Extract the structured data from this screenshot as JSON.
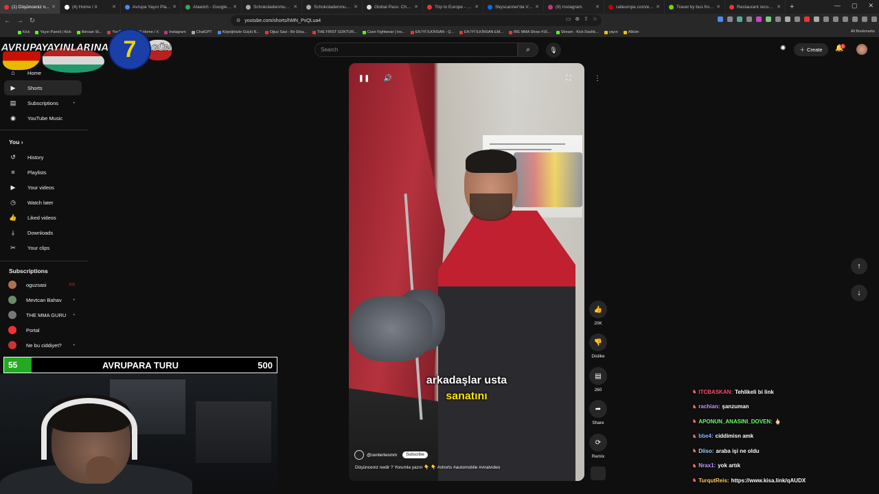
{
  "browser": {
    "tabs": [
      {
        "title": "(1) Düşünceniz n...",
        "color": "#e33",
        "active": true
      },
      {
        "title": "(4) Home / X",
        "color": "#fff"
      },
      {
        "title": "Avrupa Yayın Planlam",
        "color": "#4a8af4"
      },
      {
        "title": "Atawich - Google Maps",
        "color": "#34a853"
      },
      {
        "title": "Schokoladenmuseum Kö",
        "color": "#aaa"
      },
      {
        "title": "Schokoladenmuseum Kö",
        "color": "#aaa"
      },
      {
        "title": "Global Pass: Cheapest R",
        "color": "#ddd"
      },
      {
        "title": "Trip to Europe - Wande",
        "color": "#e33"
      },
      {
        "title": "Skyscanner'da Venedik",
        "color": "#0770e3"
      },
      {
        "title": "(9) Instagram",
        "color": "#c13584"
      },
      {
        "title": "raileurope.com/en/pass",
        "color": "#c00"
      },
      {
        "title": "Travel by bus from Colo",
        "color": "#73d700"
      },
      {
        "title": "Restaurant recommenda",
        "color": "#e33"
      }
    ],
    "new_tab": "+",
    "url": "youtube.com/shorts/hMN_PxQLua4",
    "bookmarks": [
      {
        "label": "Kick",
        "color": "#53fc18"
      },
      {
        "label": "Yayın Paneli | Kick",
        "color": "#53fc18"
      },
      {
        "label": "ilkinsan St...",
        "color": "#53fc18"
      },
      {
        "label": "YouTube",
        "color": "#e33"
      },
      {
        "label": "(4) Home / X",
        "color": "#fff"
      },
      {
        "label": "Instagram",
        "color": "#c13584"
      },
      {
        "label": "ChatGPT",
        "color": "#aaa"
      },
      {
        "label": "Köpeğinizle Güçlü B...",
        "color": "#4a8af4"
      },
      {
        "label": "Oğuz Sasi - Bir Efsa...",
        "color": "#e33"
      },
      {
        "label": "THE FIRST GOKTUR...",
        "color": "#e33"
      },
      {
        "label": "Cave Fightwear | Ins...",
        "color": "#53fc18"
      },
      {
        "label": "EN İYİ İLKİNSAN - Q...",
        "color": "#e33"
      },
      {
        "label": "EN İYİ İLKİNSAN EM...",
        "color": "#e33"
      },
      {
        "label": "IRE MMA Show #16...",
        "color": "#e33"
      },
      {
        "label": "Stream - Kick Dashb...",
        "color": "#53fc18"
      },
      {
        "label": "yayın",
        "color": "#f2c500"
      },
      {
        "label": "Albüm",
        "color": "#f2c500"
      }
    ],
    "all_bookmarks": "All Bookmarks"
  },
  "overlay_logo": {
    "text": "AVRUPAYAYINLARINA",
    "number": "7",
    "suffix": "GÜN"
  },
  "header": {
    "search_placeholder": "Search",
    "create_label": "Create",
    "notification_count": "1"
  },
  "sidebar": {
    "main": [
      {
        "label": "Home",
        "icon": "⌂"
      },
      {
        "label": "Shorts",
        "icon": "▶",
        "active": true
      },
      {
        "label": "Subscriptions",
        "icon": "▤",
        "dot": true
      },
      {
        "label": "YouTube Music",
        "icon": "◉"
      }
    ],
    "you_heading": "You",
    "you_items": [
      {
        "label": "History",
        "icon": "↺"
      },
      {
        "label": "Playlists",
        "icon": "≡"
      },
      {
        "label": "Your videos",
        "icon": "▶"
      },
      {
        "label": "Watch later",
        "icon": "◷"
      },
      {
        "label": "Liked videos",
        "icon": "👍"
      },
      {
        "label": "Downloads",
        "icon": "⤓"
      },
      {
        "label": "Your clips",
        "icon": "✂"
      }
    ],
    "subs_heading": "Subscriptions",
    "subs": [
      {
        "label": "oguzsasi",
        "color": "#b07050",
        "live": true
      },
      {
        "label": "Mevtcan Bahav",
        "color": "#6a8a6a",
        "dot": true
      },
      {
        "label": "THE MMA GURU",
        "color": "#777",
        "dot": true
      },
      {
        "label": "Portal",
        "color": "#e33"
      },
      {
        "label": "Ne bu ciddiyet?",
        "color": "#c33",
        "dot": true
      }
    ]
  },
  "video": {
    "caption_line1": "arkadaşlar usta",
    "caption_line2": "sanatını",
    "channel": "@centertesmm",
    "subscribe": "Subscribe",
    "description": "Düşünceniz nedir ? Yorumla yazın 👇 👇 #shorts #automobile #viralvideo"
  },
  "actions": {
    "likes": "20K",
    "dislike": "Dislike",
    "comments": "260",
    "share": "Share",
    "remix": "Remix"
  },
  "stream_overlay": {
    "counter_left": "55",
    "counter_title": "AVRUPARA TURU",
    "counter_right": "500"
  },
  "chat": [
    {
      "user": "ITCBASKAN:",
      "color": "#ff4d6d",
      "msg": "Tehlikeli bi link"
    },
    {
      "user": "rachian:",
      "color": "#c79bff",
      "msg": "şanzuman"
    },
    {
      "user": "APONUN_ANASINI_DOVEN:",
      "color": "#6dff6d",
      "msg": "🖕🏻"
    },
    {
      "user": "bbe4:",
      "color": "#8ab4ff",
      "msg": "ciddimisn amk"
    },
    {
      "user": "Diiso:",
      "color": "#9fd8ff",
      "msg": "araba işi ne oldu"
    },
    {
      "user": "Nrax1:",
      "color": "#c79bff",
      "msg": "yok artık"
    },
    {
      "user": "TurqutReis:",
      "color": "#ffcc66",
      "msg": "https://www.kisa.link/qAUDX"
    }
  ]
}
